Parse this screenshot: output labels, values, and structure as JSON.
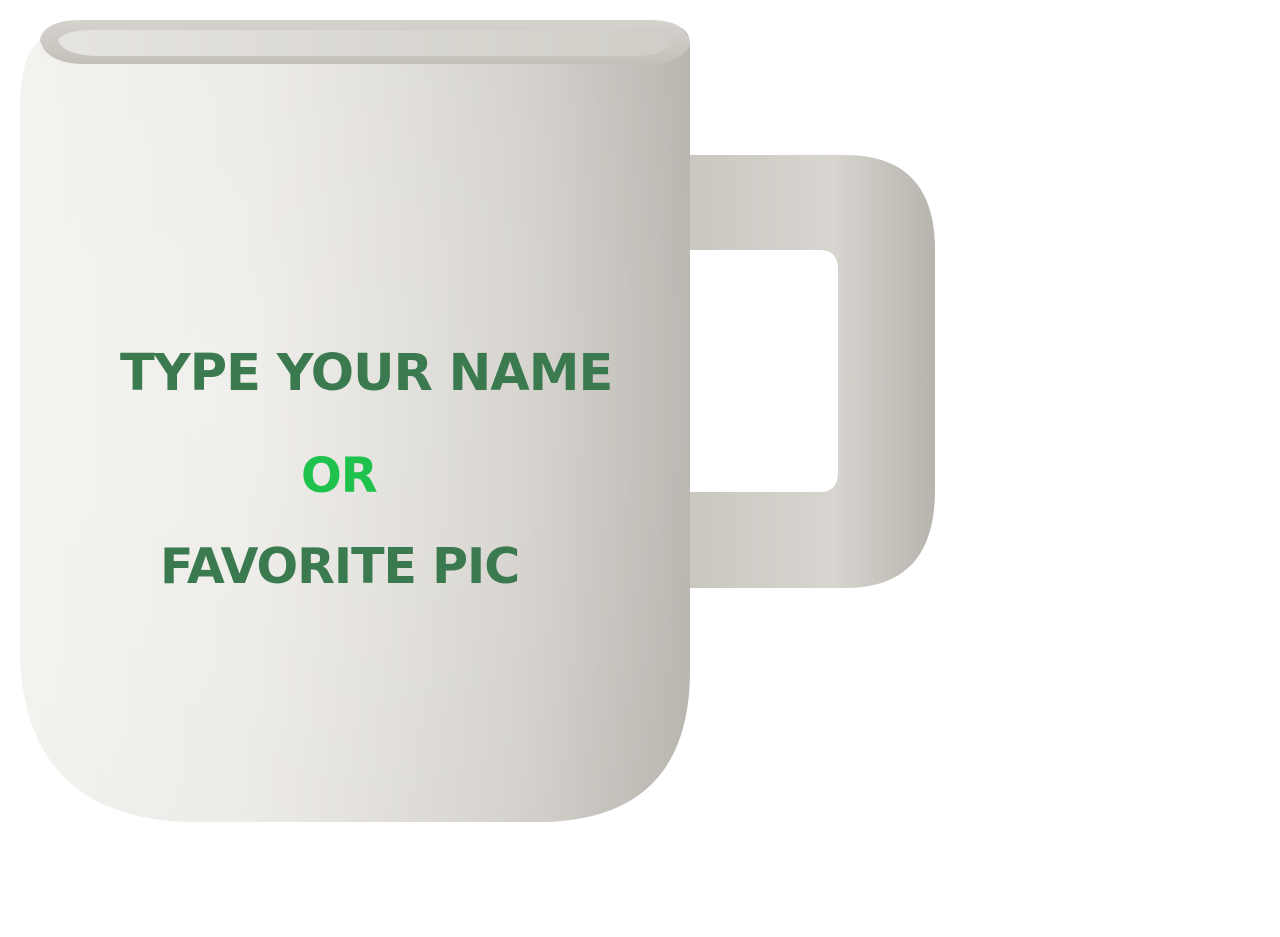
{
  "mug": {
    "line_1": "TYPE YOUR NAME",
    "line_2": "OR",
    "line_3": "FAVORITE PIC"
  },
  "colors": {
    "text_dark_green": "#3a7a4e",
    "text_bright_green": "#1fc24d",
    "mug_light": "#efeeea",
    "mug_mid": "#cfccc7",
    "mug_shadow": "#aeaaa4",
    "background": "#ffffff"
  }
}
